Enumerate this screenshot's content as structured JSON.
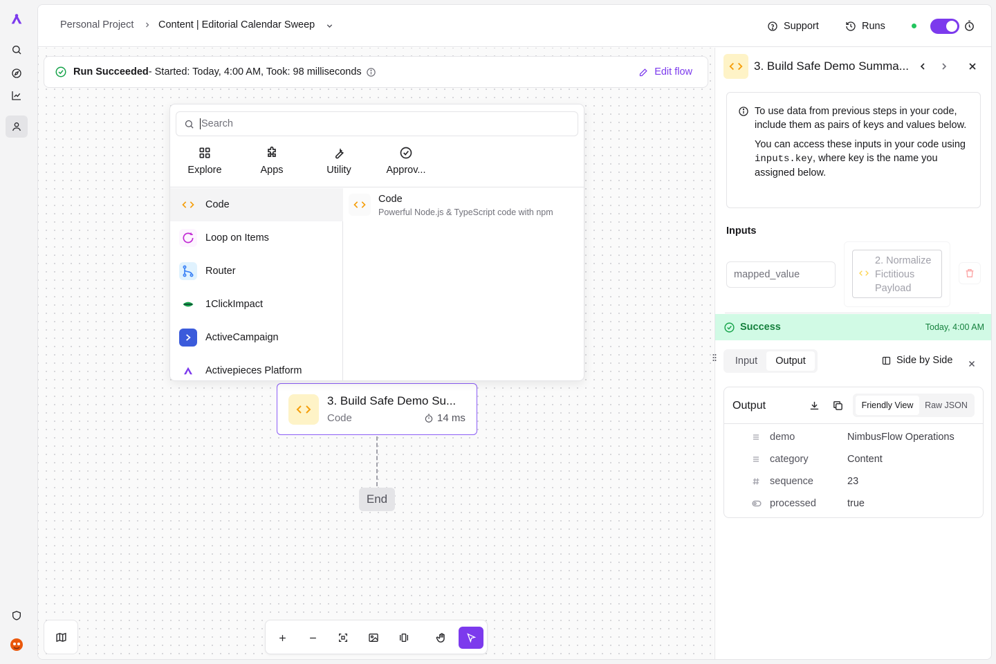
{
  "breadcrumb": {
    "project": "Personal Project",
    "flow": "Content | Editorial Calendar Sweep"
  },
  "topbar": {
    "support": "Support",
    "runs": "Runs"
  },
  "runbar": {
    "status": "Run Succeeded",
    "details": " - Started: Today, 4:00 AM, Took: 98 milliseconds",
    "edit": "Edit flow"
  },
  "picker": {
    "search_placeholder": "Search",
    "tabs": [
      "Explore",
      "Apps",
      "Utility",
      "Approv..."
    ],
    "items": [
      "Code",
      "Loop on Items",
      "Router",
      "1ClickImpact",
      "ActiveCampaign",
      "Activepieces Platform"
    ],
    "detail": {
      "title": "Code",
      "desc": "Powerful Node.js & TypeScript code with npm"
    }
  },
  "node": {
    "title": "3. Build Safe Demo Su...",
    "type": "Code",
    "duration": "14 ms"
  },
  "end_label": "End",
  "panel": {
    "title": "3. Build Safe Demo Summa...",
    "info_p1": "To use data from previous steps in your code, include them as pairs of keys and values below.",
    "info_p2_a": "You can access these inputs in your code using ",
    "info_p2_code": "inputs.key",
    "info_p2_b": ", where key is the name you assigned below.",
    "inputs_label": "Inputs",
    "input_key": "mapped_value",
    "input_value": "2. Normalize Fictitious Payload",
    "status": "Success",
    "status_time": "Today, 4:00 AM",
    "tab_input": "Input",
    "tab_output": "Output",
    "side_by_side": "Side by Side",
    "output_title": "Output",
    "view_friendly": "Friendly View",
    "view_raw": "Raw JSON",
    "rows": [
      {
        "key": "demo",
        "value": "NimbusFlow Operations"
      },
      {
        "key": "category",
        "value": "Content"
      },
      {
        "key": "sequence",
        "value": "23"
      },
      {
        "key": "processed",
        "value": "true"
      }
    ]
  },
  "colors": {
    "accent": "#7c3aed",
    "success": "#16a34a",
    "success_bg": "#d1fae5",
    "code_orange": "#f59e0b"
  }
}
